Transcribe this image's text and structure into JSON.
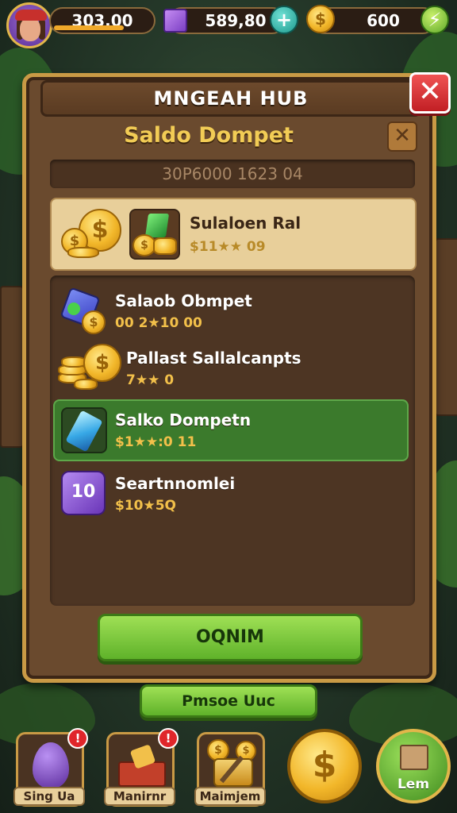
{
  "topbar": {
    "xp_value": "303.00",
    "xp_progress": 0.72,
    "gems_value": "589,80",
    "gold_value": "600"
  },
  "panel": {
    "header_title": "MNGEAH HUB",
    "subtitle": "Saldo Dompet",
    "info_text": "30P6000 1623 04",
    "featured": {
      "title": "Sulaloen Ral",
      "sub": "$11★★ 09"
    },
    "items": [
      {
        "title": "Salaob Obmpet",
        "sub": "00 2★10 00",
        "icon": "gem-and-coin-icon",
        "selected": false
      },
      {
        "title": "Pallast Sallalcanpts",
        "sub": "7★★ 0",
        "icon": "coin-stack-icon",
        "selected": false
      },
      {
        "title": "Salko Dompetn",
        "sub": "$1★★:0 11",
        "icon": "blue-crystal-icon",
        "selected": true
      },
      {
        "title": "Seartnnomlei",
        "sub": "$10★5Q",
        "icon": "purple-box-icon",
        "selected": false
      }
    ],
    "confirm_label": "OQNIM",
    "secondary_label": "Pmsoe Uuc"
  },
  "bottom_nav": [
    {
      "label": "Sing Ua",
      "badge": "!",
      "icon": "purple-egg-icon"
    },
    {
      "label": "Manirnr",
      "badge": "!",
      "icon": "treasure-chest-icon"
    },
    {
      "label": "Maimjem",
      "badge": "",
      "icon": "tools-icon"
    }
  ],
  "coin_button_icon": "gold-coin-icon",
  "lem_button": {
    "label": "Lem",
    "icon": "crate-icon"
  },
  "colors": {
    "panel_border": "#c99a45",
    "close_red": "#d8282c",
    "accent_green": "#6fbe34",
    "gold": "#f2b72a"
  }
}
